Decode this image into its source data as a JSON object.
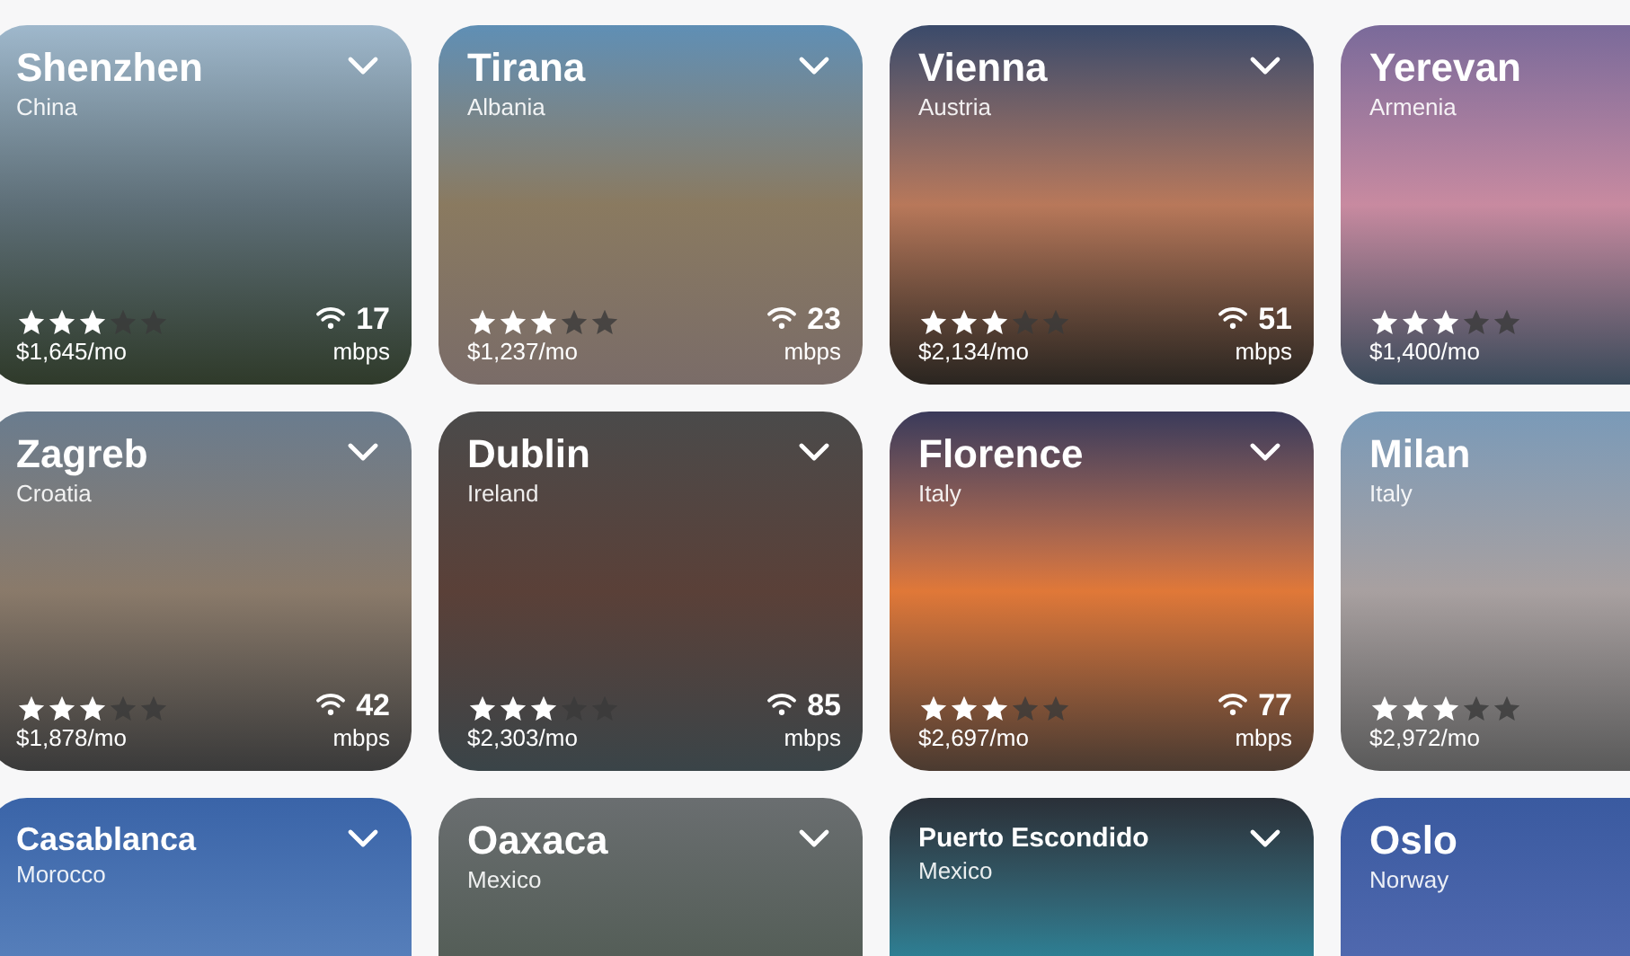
{
  "cities": [
    {
      "city": "Shenzhen",
      "country": "China",
      "stars": 3,
      "price": "$1,645/mo",
      "speed": "17",
      "unit": "mbps"
    },
    {
      "city": "Tirana",
      "country": "Albania",
      "stars": 3,
      "price": "$1,237/mo",
      "speed": "23",
      "unit": "mbps"
    },
    {
      "city": "Vienna",
      "country": "Austria",
      "stars": 3,
      "price": "$2,134/mo",
      "speed": "51",
      "unit": "mbps"
    },
    {
      "city": "Yerevan",
      "country": "Armenia",
      "stars": 3,
      "price": "$1,400/mo"
    },
    {
      "city": "Zagreb",
      "country": "Croatia",
      "stars": 3,
      "price": "$1,878/mo",
      "speed": "42",
      "unit": "mbps"
    },
    {
      "city": "Dublin",
      "country": "Ireland",
      "stars": 3,
      "price": "$2,303/mo",
      "speed": "85",
      "unit": "mbps"
    },
    {
      "city": "Florence",
      "country": "Italy",
      "stars": 3,
      "price": "$2,697/mo",
      "speed": "77",
      "unit": "mbps"
    },
    {
      "city": "Milan",
      "country": "Italy",
      "stars": 3,
      "price": "$2,972/mo"
    },
    {
      "city": "Casablanca",
      "country": "Morocco"
    },
    {
      "city": "Oaxaca",
      "country": "Mexico"
    },
    {
      "city": "Puerto Escondido",
      "country": "Mexico"
    },
    {
      "city": "Oslo",
      "country": "Norway"
    }
  ]
}
